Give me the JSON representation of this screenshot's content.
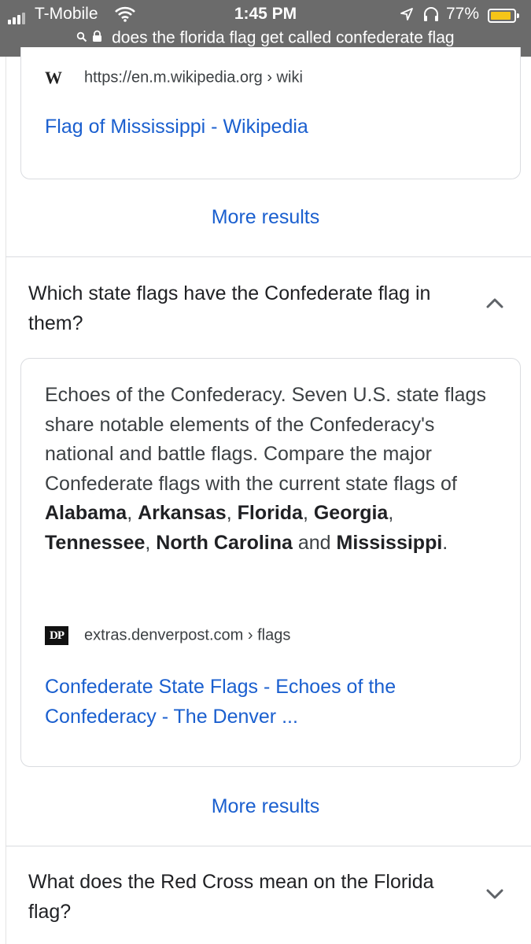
{
  "status_bar": {
    "carrier": "T-Mobile",
    "time": "1:45 PM",
    "battery_percent": "77%",
    "battery_level": 0.77,
    "battery_color": "#f5c518",
    "url_text": "does the florida flag get called confederate flag"
  },
  "result_top": {
    "favicon_letter": "W",
    "source": "https://en.m.wikipedia.org › wiki",
    "title": "Flag of Mississippi - Wikipedia"
  },
  "more_results_1": "More results",
  "faq": [
    {
      "question": "Which state flags have the Confederate flag in them?",
      "expanded": true,
      "answer": {
        "intro": "Echoes of the Confederacy. Seven U.S. state flags share notable elements of the Confederacy's national and battle flags. Compare the major Confederate flags with the current state flags of ",
        "states": [
          "Alabama",
          "Arkansas",
          "Florida",
          "Georgia",
          "Tennessee",
          "North Carolina",
          "Mississippi"
        ],
        "sep1": ", ",
        "sep_and": " and ",
        "end": "."
      },
      "favicon_letter": "DP",
      "source": "extras.denverpost.com › flags",
      "title": "Confederate State Flags - Echoes of the Confederacy - The Denver ..."
    },
    {
      "question": "What does the Red Cross mean on the Florida flag?",
      "expanded": false
    }
  ],
  "more_results_2": "More results",
  "colors": {
    "link": "#1a5fcf",
    "status_bar_bg": "#6b6b6b",
    "text": "#202124"
  },
  "icons": [
    "signal-icon",
    "wifi-icon",
    "location-icon",
    "headphones-icon",
    "battery-icon",
    "search-icon",
    "lock-icon",
    "chevron-up-icon",
    "chevron-down-icon"
  ]
}
